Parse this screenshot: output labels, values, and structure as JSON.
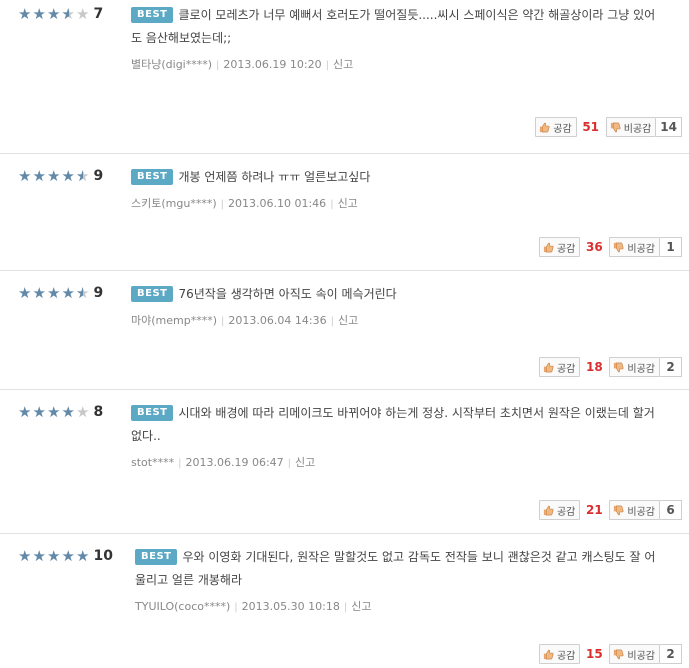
{
  "reviews": [
    {
      "stars": [
        1,
        1,
        1,
        0.5,
        0
      ],
      "score": "7",
      "badge": "BEST",
      "text": "클로이 모레츠가 너무 예뻐서 호러도가 떨어질듯.....씨시 스페이식은 약간 해골상이라 그냥 있어도 음산해보였는데;;",
      "author": "별타냥(digi****)",
      "date": "2013.06.19 10:20",
      "report": "신고",
      "like_label": "공감",
      "like_count": "51",
      "dislike_label": "비공감",
      "dislike_count": "14"
    },
    {
      "stars": [
        1,
        1,
        1,
        1,
        0.5
      ],
      "score": "9",
      "badge": "BEST",
      "text": "개봉 언제쯤 하려나 ㅠㅠ 얼른보고싶다",
      "author": "스키토(mgu****)",
      "date": "2013.06.10 01:46",
      "report": "신고",
      "like_label": "공감",
      "like_count": "36",
      "dislike_label": "비공감",
      "dislike_count": "1"
    },
    {
      "stars": [
        1,
        1,
        1,
        1,
        0.5
      ],
      "score": "9",
      "badge": "BEST",
      "text": "76년작을 생각하면 아직도 속이 메슥거린다",
      "author": "마야(memp****)",
      "date": "2013.06.04 14:36",
      "report": "신고",
      "like_label": "공감",
      "like_count": "18",
      "dislike_label": "비공감",
      "dislike_count": "2"
    },
    {
      "stars": [
        1,
        1,
        1,
        1,
        0
      ],
      "score": "8",
      "badge": "BEST",
      "text": "시대와 배경에 따라 리메이크도 바뀌어야 하는게 정상. 시작부터 초치면서 원작은 이랬는데 할거없다..",
      "author": "stot****",
      "date": "2013.06.19 06:47",
      "report": "신고",
      "like_label": "공감",
      "like_count": "21",
      "dislike_label": "비공감",
      "dislike_count": "6"
    },
    {
      "stars": [
        1,
        1,
        1,
        1,
        1
      ],
      "score": "10",
      "badge": "BEST",
      "text": "우와 이영화 기대된다, 원작은 말할것도 없고 감독도 전작들 보니 괜찮은것 같고 캐스팅도 잘 어울리고 얼른 개봉해라",
      "author": "TYUILO(coco****)",
      "date": "2013.05.30 10:18",
      "report": "신고",
      "like_label": "공감",
      "like_count": "15",
      "dislike_label": "비공감",
      "dislike_count": "2"
    }
  ],
  "colors": {
    "star_filled": "#6389a8",
    "star_empty": "#c8c8c8",
    "best_badge": "#5ba9c5",
    "like_count": "#d9302f",
    "dislike_count": "#555555"
  },
  "icons": {
    "like": "thumbs-up-icon",
    "dislike": "thumbs-down-icon",
    "star": "star-icon"
  }
}
